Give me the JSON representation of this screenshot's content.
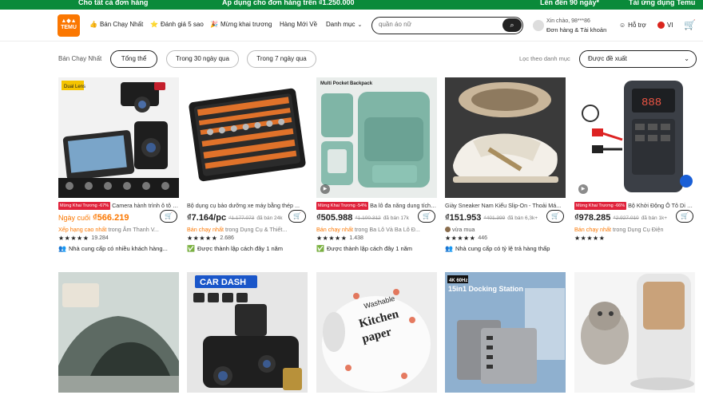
{
  "promo": {
    "left_text": "Cho tất cả đơn hàng",
    "center_text": "Áp dụng cho đơn hàng trên ₫1.250.000",
    "right_text": "Lên đến 90 ngày*",
    "far_right_text": "Tải ứng dụng Temu"
  },
  "header": {
    "logo_text": "TEMU",
    "nav": [
      {
        "label": "Bán Chạy Nhất",
        "icon": "thumbs-up-icon"
      },
      {
        "label": "Đánh giá 5 sao",
        "icon": "star-badge-icon"
      },
      {
        "label": "Mừng khai trương",
        "icon": "party-icon"
      },
      {
        "label": "Hàng Mới Về",
        "icon": ""
      },
      {
        "label": "Danh mục",
        "icon": "chevron-down-icon"
      }
    ],
    "search_placeholder": "quần áo nữ",
    "account_greeting": "Xin chào, 98***86",
    "account_label": "Đơn hàng & Tài khoản",
    "help_label": "Hỗ trợ",
    "lang_label": "VI"
  },
  "filters": {
    "section_label": "Bán Chạy Nhất",
    "pills": [
      "Tổng thể",
      "Trong 30 ngày qua",
      "Trong 7 ngày qua"
    ],
    "category_label": "Lọc theo danh mục",
    "sort_value": "Được đề xuất"
  },
  "products": [
    {
      "badge": "Mừng Khai Trương -67%",
      "title": "Camera hành trình ô tô 10...",
      "price_prefix": "Ngày cuối",
      "price": "₫566.219",
      "orig": "",
      "sold": "",
      "line3_hl": "Xếp hạng cao nhất",
      "line3": " trong Âm Thanh V...",
      "stars": "★★★★★",
      "rating_count": "19.284",
      "line5": "Nhà cung cấp có nhiều khách hàng..."
    },
    {
      "badge": "",
      "title": "Bộ dụng cụ bảo dưỡng xe máy bằng thép ...",
      "price_prefix": "",
      "price": "₫7.164/pc",
      "orig": "₫1.177.073",
      "sold": "đã bán 24k",
      "line3_hl": "Bán chạy nhất",
      "line3": " trong Dụng Cụ & Thiết...",
      "stars": "★★★★★",
      "rating_count": "2.686",
      "line5": "Được thành lập cách đây 1 năm"
    },
    {
      "badge": "Mừng Khai Trương -54%",
      "title": "Ba lô đa năng dung tích lớ...",
      "price_prefix": "",
      "price": "₫505.988",
      "orig": "₫1.100.312",
      "sold": "đã bán 17k",
      "line3_hl": "Bán chạy nhất",
      "line3": " trong Ba Lô Và Ba Lô Đ...",
      "stars": "★★★★★",
      "rating_count": "1.438",
      "line5": "Được thành lập cách đây 1 năm"
    },
    {
      "badge": "",
      "title": "Giày Sneaker Nam Kiểu Slip-On - Thoải Má...",
      "price_prefix": "",
      "price": "₫151.953",
      "orig": "₫401.399",
      "sold": "đã bán 6,3k+",
      "line3_hl": "",
      "line3": "vừa mua",
      "stars": "★★★★★",
      "rating_count": "446",
      "line5": "Nhà cung cấp có tỷ lệ trả hàng thấp"
    },
    {
      "badge": "Mừng Khai Trương -66%",
      "title": "Bộ Khởi Động Ô Tô Di Độn...",
      "price_prefix": "",
      "price": "₫978.285",
      "orig": "₫2.927.010",
      "sold": "đã bán 1k+",
      "line3_hl": "Bán chạy nhất",
      "line3": " trong Dụng Cụ Điện",
      "stars": "★★★★★",
      "rating_count": "",
      "line5": ""
    }
  ],
  "image_texts": {
    "dual_lens": "Dual Lens",
    "backpack": "Multi Pocket Backpack",
    "car_dash": "CAR DASH",
    "kitchen": "Washable Kitchen paper",
    "dock": "15in1 Docking Station",
    "dock_tag": "4K 60Hz"
  },
  "colors": {
    "accent": "#fb7701",
    "badge": "#e0233c",
    "green": "#0a8a3a"
  }
}
